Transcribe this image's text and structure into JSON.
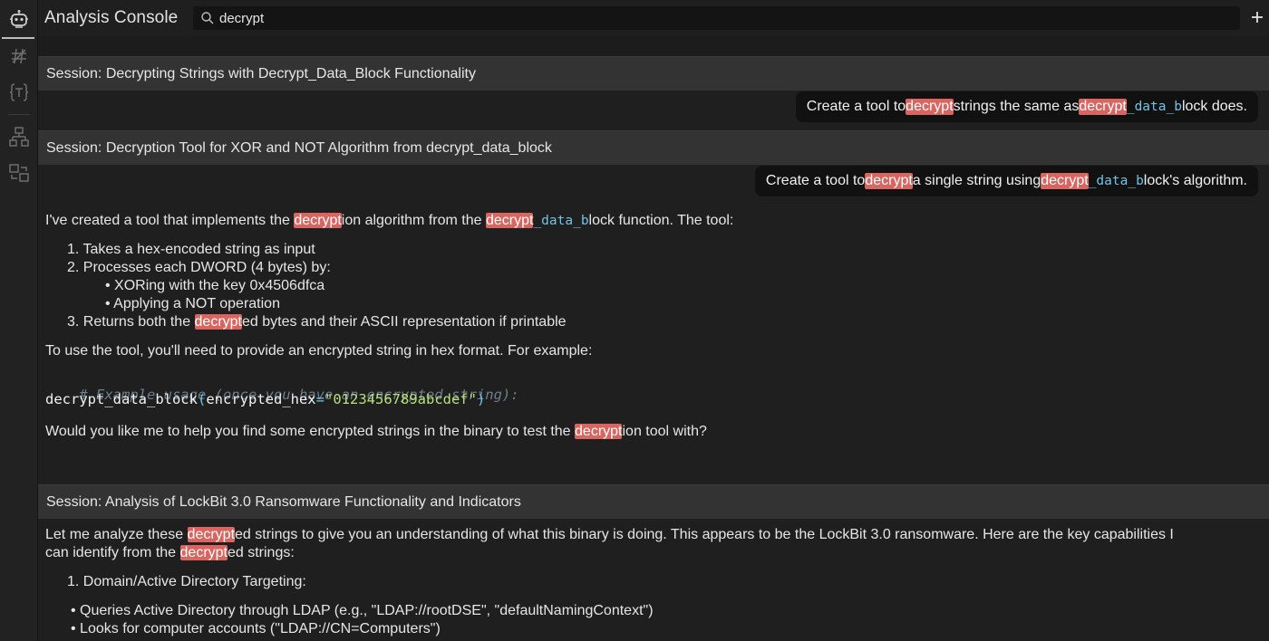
{
  "app": {
    "title": "Analysis Console"
  },
  "search": {
    "value": "decrypt",
    "placeholder": ""
  },
  "rail": {
    "icons": [
      "robot-icon",
      "hash-icon",
      "braces-t-icon",
      "hierarchy-icon",
      "transfer-icon"
    ]
  },
  "colors": {
    "highlight": "#d96561",
    "header_bg": "#333333",
    "bubble_bg": "#111111",
    "code_blue": "#72c3e6",
    "code_string": "#b8e07a"
  },
  "sessions": [
    {
      "title": "Session: Decrypting Strings with Decrypt_Data_Block Functionality",
      "user_message": {
        "pre": "Create a tool to ",
        "hl1": "decrypt",
        "mid": " strings the same as ",
        "hl2": "decrypt",
        "code": "_data_b",
        "post": "lock does."
      }
    },
    {
      "title": "Session: Decryption Tool for XOR and NOT Algorithm from decrypt_data_block",
      "user_message": {
        "pre": "Create a tool to ",
        "hl1": "decrypt",
        "mid": " a single string using ",
        "hl2": "decrypt",
        "code": "_data_b",
        "post": "lock's algorithm."
      },
      "assistant": {
        "intro": {
          "a": "I've created a tool that implements the ",
          "hl1": "decrypt",
          "b": "ion algorithm from the ",
          "hl2": "decrypt",
          "code": "_data_b",
          "c": "lock function. The tool:"
        },
        "steps": [
          "1. Takes a hex-encoded string as input",
          "2. Processes each DWORD (4 bytes) by:"
        ],
        "substeps": [
          "• XORing with the key 0x4506dfca",
          "• Applying a NOT operation"
        ],
        "step3": {
          "a": "3. Returns both the ",
          "hl": "decrypt",
          "b": "ed bytes and their ASCII representation if printable"
        },
        "usage_text": "To use the tool, you'll need to provide an encrypted string in hex format. For example:",
        "code_comment": "# Example usage (once you have an encrypted string):",
        "code_fn": "decrypt_data_block",
        "code_open": "(",
        "code_arg": "encrypted_hex",
        "code_eq": "=",
        "code_str": "\"0123456789abcdef\"",
        "code_close": ")",
        "closing": {
          "a": "Would you like me to help you find some encrypted strings in the binary to test the ",
          "hl": "decrypt",
          "b": "ion tool with?"
        }
      }
    },
    {
      "title": "Session: Analysis of LockBit 3.0 Ransomware Functionality and Indicators",
      "assistant": {
        "p1": {
          "a": "Let me analyze these ",
          "hl1": "decrypt",
          "b": "ed strings to give you an understanding of what this binary is doing. This appears to be the LockBit 3.0 ransomware. Here are the key capabilities I can identify from the ",
          "hl2": "decrypt",
          "c": "ed strings:"
        },
        "item1": "1. Domain/Active Directory Targeting:",
        "bullets": [
          "• Queries Active Directory through LDAP (e.g., \"LDAP://rootDSE\", \"defaultNamingContext\")",
          "• Looks for computer accounts (\"LDAP://CN=Computers\")"
        ]
      }
    }
  ]
}
